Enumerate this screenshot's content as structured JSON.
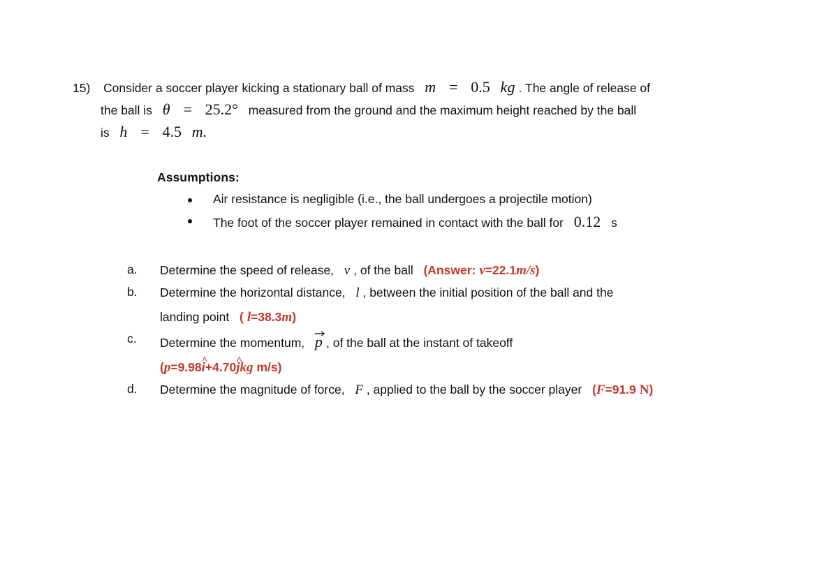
{
  "document": {
    "type": "physics-problem-worksheet",
    "background_color": "#ffffff",
    "answer_color": "#C0392B",
    "text_color": "#111111"
  },
  "question": {
    "number": "15)",
    "line1": {
      "part1": "Consider a soccer player kicking a stationary ball of mass",
      "var_m": "m",
      "eq1": "=",
      "val_mass": "0.5",
      "unit_kg": "kg",
      "part2": ". The angle of release of"
    },
    "line2": {
      "part1": "the ball is",
      "var_theta": "θ",
      "eq1": "=",
      "val_angle": "25.2°",
      "part2": "measured from the ground and the maximum height reached by the ball"
    },
    "line3": {
      "part1": "is",
      "var_h": "h",
      "eq1": "=",
      "val_height": "4.5",
      "unit_m": "m."
    }
  },
  "assumptions": {
    "title": "Assumptions:",
    "items": [
      {
        "text": "Air resistance is negligible (i.e., the ball undergoes a projectile motion)",
        "value": "",
        "unit": ""
      },
      {
        "text": "The foot of the soccer player remained in contact with the ball for",
        "value": "0.12",
        "unit": "s"
      }
    ]
  },
  "parts": [
    {
      "marker": "a.",
      "line1_pre": "Determine the speed of release,",
      "line1_var": "v",
      "line1_post": ", of the ball",
      "answer_label": "(Answer:",
      "answer_var": "v",
      "answer_eq": "=",
      "answer_value": "22.1",
      "answer_unit": "m/s",
      "answer_close": ")"
    },
    {
      "marker": "b.",
      "line1_pre": "Determine the horizontal distance,",
      "line1_var": "l",
      "line1_post": ", between the initial position of the ball and the",
      "line2_pre": "landing point",
      "answer_open": "(",
      "answer_var": "l",
      "answer_eq": "=",
      "answer_value": "38.3",
      "answer_unit": "m",
      "answer_close": ")"
    },
    {
      "marker": "c.",
      "line1_pre": "Determine the momentum,",
      "line1_var": "p",
      "line1_post": ", of the ball at the instant of takeoff",
      "answer_open": "(",
      "answer_var": "p",
      "answer_eq": "=",
      "answer_x_value": "9.98",
      "answer_x_unit": "i",
      "answer_plus": "+",
      "answer_y_value": "4.70",
      "answer_y_unit": "j",
      "answer_mass_unit": "kg",
      "answer_vel_unit": "m/s",
      "answer_close": ")"
    },
    {
      "marker": "d.",
      "line1_pre": "Determine the magnitude of force,",
      "line1_var": "F",
      "line1_post": ", applied to the ball by the soccer player",
      "answer_open": "(",
      "answer_var": "F",
      "answer_eq": "=",
      "answer_value": "91.9",
      "answer_unit": "N",
      "answer_close": ")"
    }
  ]
}
